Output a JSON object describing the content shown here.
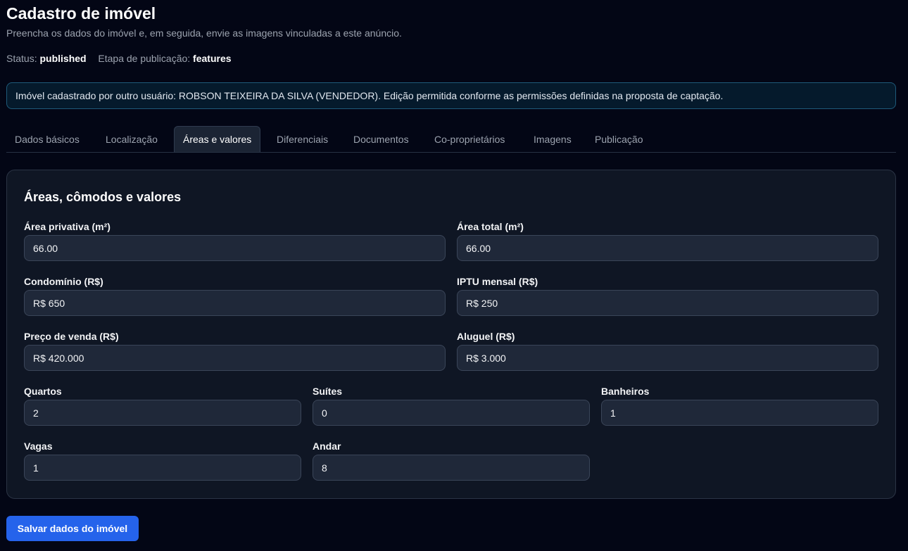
{
  "header": {
    "title": "Cadastro de imóvel",
    "subtitle": "Preencha os dados do imóvel e, em seguida, envie as imagens vinculadas a este anúncio.",
    "status_label": "Status:",
    "status_value": "published",
    "stage_label": "Etapa de publicação:",
    "stage_value": "features"
  },
  "notice": {
    "text": "Imóvel cadastrado por outro usuário: ROBSON TEIXEIRA DA SILVA (VENDEDOR). Edição permitida conforme as permissões definidas na proposta de captação."
  },
  "tabs": [
    {
      "label": "Dados básicos"
    },
    {
      "label": "Localização"
    },
    {
      "label": "Áreas e valores"
    },
    {
      "label": "Diferenciais"
    },
    {
      "label": "Documentos"
    },
    {
      "label": "Co-proprietários"
    },
    {
      "label": "Imagens"
    },
    {
      "label": "Publicação"
    }
  ],
  "active_tab": "Áreas e valores",
  "form": {
    "title": "Áreas, cômodos e valores",
    "fields": {
      "area_privativa": {
        "label": "Área privativa (m²)",
        "value": "66.00"
      },
      "area_total": {
        "label": "Área total (m²)",
        "value": "66.00"
      },
      "condominio": {
        "label": "Condomínio (R$)",
        "value": "R$ 650"
      },
      "iptu": {
        "label": "IPTU mensal (R$)",
        "value": "R$ 250"
      },
      "preco_venda": {
        "label": "Preço de venda (R$)",
        "value": "R$ 420.000"
      },
      "aluguel": {
        "label": "Aluguel (R$)",
        "value": "R$ 3.000"
      },
      "quartos": {
        "label": "Quartos",
        "value": "2"
      },
      "suites": {
        "label": "Suítes",
        "value": "0"
      },
      "banheiros": {
        "label": "Banheiros",
        "value": "1"
      },
      "vagas": {
        "label": "Vagas",
        "value": "1"
      },
      "andar": {
        "label": "Andar",
        "value": "8"
      }
    }
  },
  "actions": {
    "save_label": "Salvar dados do imóvel"
  },
  "colors": {
    "background": "#030615",
    "card": "#0f1624",
    "input": "#1f2839",
    "primary_button": "#2563eb",
    "notice_border": "#1e5a7a"
  }
}
